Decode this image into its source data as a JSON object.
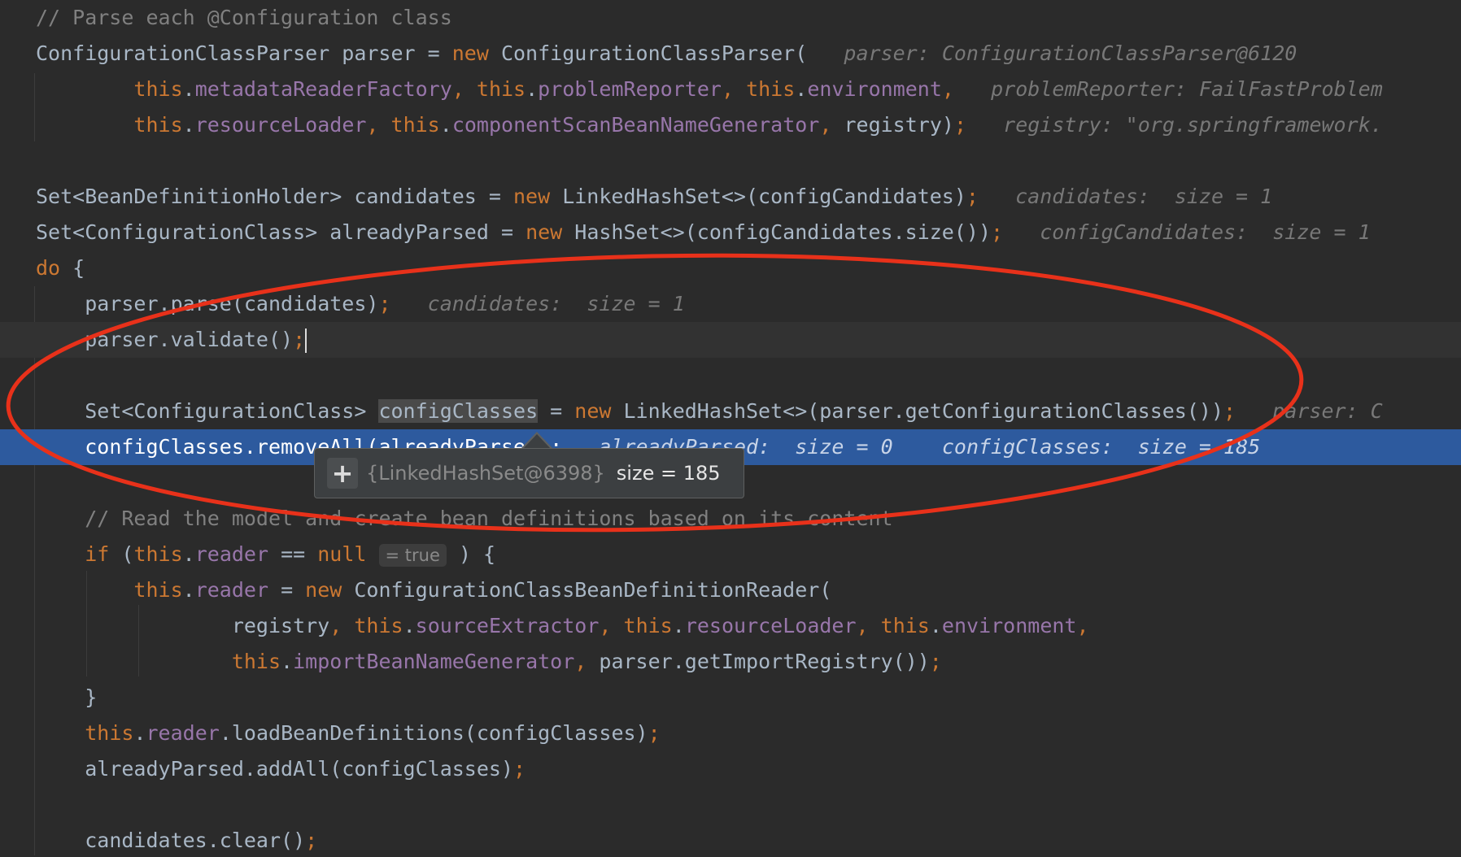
{
  "code": {
    "l1": {
      "comment": "// Parse each @Configuration class"
    },
    "l2": {
      "decl": "ConfigurationClassParser parser = ",
      "kw_new": "new",
      "rest": " ConfigurationClassParser(",
      "hint": "parser: ConfigurationClassParser@6120"
    },
    "l3": {
      "this": "this",
      "f1": "metadataReaderFactory",
      "this2": "this",
      "f2": "problemReporter",
      "this3": "this",
      "f3": "environment",
      "hint": "problemReporter: FailFastProblem"
    },
    "l4": {
      "this": "this",
      "f1": "resourceLoader",
      "this2": "this",
      "f2": "componentScanBeanNameGenerator",
      "rest": "registry)",
      "hint": "registry: \"org.springframework."
    },
    "l6": {
      "decl": "Set<BeanDefinitionHolder> candidates = ",
      "kw_new": "new",
      "rest": " LinkedHashSet<>(configCandidates)",
      "hint": "candidates:  size = 1"
    },
    "l7": {
      "decl": "Set<ConfigurationClass> alreadyParsed = ",
      "kw_new": "new",
      "rest": " HashSet<>(configCandidates.size())",
      "hint": "configCandidates:  size = 1"
    },
    "l8": {
      "kw_do": "do",
      "rest": " {"
    },
    "l9": {
      "code": "parser.parse(candidates)",
      "hint": "candidates:  size = 1"
    },
    "l10": {
      "code": "parser.validate()"
    },
    "l12": {
      "type": "Set<ConfigurationClass> ",
      "var": "configClasses",
      "mid": " = ",
      "kw_new": "new",
      "rest": " LinkedHashSet<>(parser.getConfigurationClasses())",
      "hint": "parser: C"
    },
    "l13": {
      "code": "configClasses.removeAll(alreadyParsed)",
      "hint1": "alreadyParsed:  size = 0",
      "hint2": "configClasses:  size = 185"
    },
    "l15": {
      "comment": "// Read the model and create bean definitions based on its content"
    },
    "l16": {
      "kw_if": "if",
      "open": " (",
      "this": "this",
      "field": "reader",
      "mid": " == ",
      "kw_null": "null",
      "inlay": "= true",
      "close": " ) {"
    },
    "l17": {
      "this": "this",
      "field": "reader",
      "mid": " = ",
      "kw_new": "new",
      "rest": " ConfigurationClassBeanDefinitionReader("
    },
    "l18": {
      "arg": "registry",
      "this": "this",
      "f1": "sourceExtractor",
      "this2": "this",
      "f2": "resourceLoader",
      "this3": "this",
      "f3": "environment"
    },
    "l19": {
      "this": "this",
      "f1": "importBeanNameGenerator",
      "rest": "parser.getImportRegistry())"
    },
    "l20": {
      "brace": "}"
    },
    "l21": {
      "this": "this",
      "field": "reader",
      "rest": ".loadBeanDefinitions(configClasses)"
    },
    "l22": {
      "code": "alreadyParsed.addAll(configClasses)"
    },
    "l24": {
      "code": "candidates.clear()"
    }
  },
  "tooltip": {
    "expand_label": "+",
    "object_id": "{LinkedHashSet@6398}",
    "size_label": "size = 185"
  },
  "colors": {
    "background": "#2b2b2b",
    "keyword": "#cc7832",
    "field": "#9876aa",
    "comment": "#808080",
    "text": "#a9b7c6",
    "execution_line": "#2d5a9e",
    "annotation": "#e8311a"
  },
  "icons": {
    "expand": "plus-icon"
  }
}
